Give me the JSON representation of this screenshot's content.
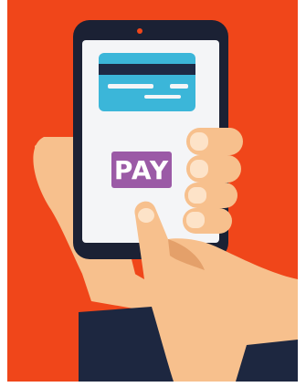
{
  "colors": {
    "background": "#f0461a",
    "phone_body": "#1b2134",
    "screen": "#f4f5f7",
    "card": "#3bb6d9",
    "card_stripe": "#1e2a45",
    "pay_button": "#9b5aa6",
    "skin": "#f7c08d",
    "skin_shadow": "#e4a06a",
    "nail": "#fde3c8",
    "sleeve": "#1d2740"
  },
  "icons": [
    "credit-card-icon"
  ],
  "pay_button": {
    "label": "PAY"
  }
}
